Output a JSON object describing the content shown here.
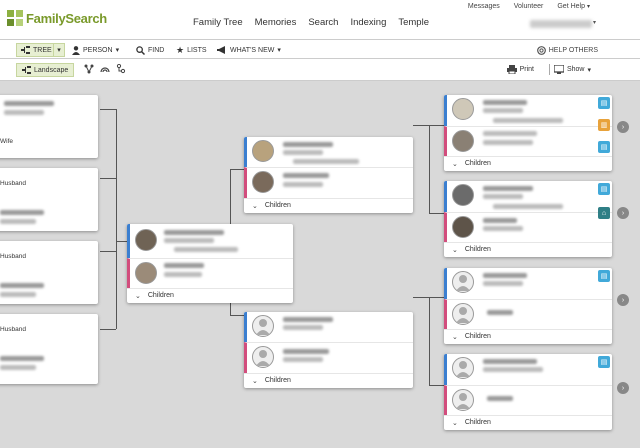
{
  "header": {
    "logo_text": "FamilySearch",
    "nav": [
      "Family Tree",
      "Memories",
      "Search",
      "Indexing",
      "Temple"
    ],
    "util": [
      "Messages",
      "Volunteer",
      "Get Help"
    ]
  },
  "toolbar": {
    "tree": "TREE",
    "person": "PERSON",
    "find": "FIND",
    "lists": "LISTS",
    "whats_new": "WHAT'S NEW",
    "help_others": "HELP OTHERS"
  },
  "subbar": {
    "landscape": "Landscape",
    "print": "Print",
    "show": "Show"
  },
  "tree": {
    "children_label": "Children",
    "left_roles": [
      "Wife",
      "Husband",
      "Husband",
      "Husband"
    ]
  },
  "colors": {
    "male": "#3b7fd0",
    "female": "#d24d7d",
    "brand": "#7a9a2b",
    "hint_badge": "#41a9d9",
    "record_badge": "#e8a23b",
    "temple_badge": "#2f7f86"
  }
}
